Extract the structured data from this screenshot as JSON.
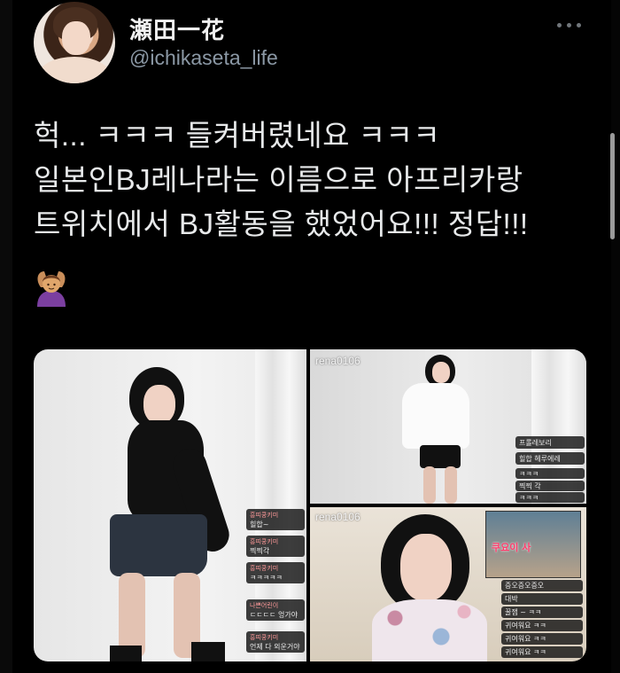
{
  "user": {
    "display_name": "瀬田一花",
    "handle": "@ichikaseta_life"
  },
  "tweet": {
    "lines": [
      "헉... ㅋㅋㅋ 들켜버렸네요 ㅋㅋㅋ",
      "일본인BJ레나라는 이름으로 아프리카랑",
      "트위치에서 BJ활동을 했었어요!!! 정답!!!"
    ],
    "emoji": "person-gesturing-ok-icon"
  },
  "media": {
    "top_right_watermark": "rena0106",
    "bottom_right_watermark": "rena0106",
    "tv_caption": "쿠요이 사",
    "left_chat": [
      {
        "name": "흥띠쿵키미",
        "body": "힐합~"
      },
      {
        "name": "흥띠쿵키미",
        "body": "찍찍각"
      },
      {
        "name": "흥띠쿵키미",
        "body": "ㅋㅋㅋㅋㅋ"
      },
      {
        "name": "나쁜어린이",
        "body": "ㄷㄷㄷㄷ 엉가야"
      },
      {
        "name": "흥띠쿵키미",
        "body": "언제 다 외운거야"
      }
    ],
    "top_right_chat": [
      {
        "name": "",
        "body": "프롤레보리"
      },
      {
        "name": "",
        "body": "힐합 헤루에레"
      },
      {
        "name": "",
        "body": "ㅋㅋㅋ"
      },
      {
        "name": "",
        "body": "찍찍 각"
      },
      {
        "name": "",
        "body": "ㅋㅋㅋ"
      }
    ],
    "bottom_right_chat": [
      {
        "name": "",
        "body": "증오증오증오"
      },
      {
        "name": "",
        "body": "대박"
      },
      {
        "name": "",
        "body": "꿀잼 ~ ㅋㅋ"
      },
      {
        "name": "",
        "body": "귀여워요 ㅋㅋ"
      },
      {
        "name": "",
        "body": "귀여워요 ㅋㅋ"
      },
      {
        "name": "",
        "body": "귀여워요 ㅋㅋ"
      }
    ]
  },
  "colors": {
    "background": "#000000",
    "text": "#e7e9ea",
    "secondary_text": "#8b98a5"
  }
}
